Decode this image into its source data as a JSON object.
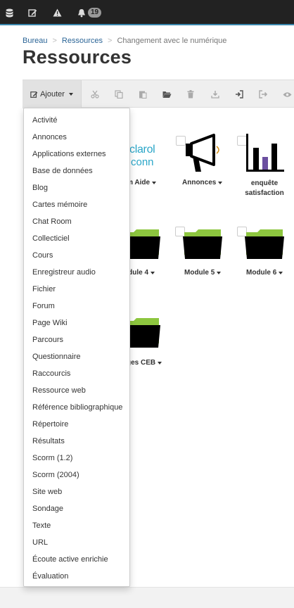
{
  "topbar": {
    "icons": [
      "database-icon",
      "edit-icon",
      "warning-icon",
      "bell-icon"
    ],
    "notifications_count": "19"
  },
  "breadcrumb": {
    "items": [
      "Bureau",
      "Ressources"
    ],
    "current": "Changement avec le numérique"
  },
  "page_title": "Ressources",
  "toolbar": {
    "add_label": "Ajouter",
    "tools": [
      "cut-icon",
      "copy-icon",
      "paste-icon",
      "open-folder-icon",
      "delete-icon",
      "download-icon",
      "import-icon",
      "export-icon",
      "view-icon"
    ]
  },
  "resources": [
    {
      "label": "um Aide",
      "icon": "claroconnect-logo"
    },
    {
      "label": "Annonces",
      "icon": "megaphone-icon"
    },
    {
      "label": "enquête satisfaction",
      "icon": "bar-chart-icon"
    },
    {
      "label": "odule 4",
      "icon": "folder-icon"
    },
    {
      "label": "Module 5",
      "icon": "folder-icon"
    },
    {
      "label": "Module 6",
      "icon": "folder-icon"
    },
    {
      "label": "ges CEB",
      "icon": "folder-icon"
    }
  ],
  "logo_text": {
    "line1": "clarol",
    "line2": "conn"
  },
  "dropdown": {
    "items": [
      "Activité",
      "Annonces",
      "Applications externes",
      "Base de données",
      "Blog",
      "Cartes mémoire",
      "Chat Room",
      "Collecticiel",
      "Cours",
      "Enregistreur audio",
      "Fichier",
      "Forum",
      "Page Wiki",
      "Parcours",
      "Questionnaire",
      "Raccourcis",
      "Ressource web",
      "Référence bibliographique",
      "Répertoire",
      "Résultats",
      "Scorm (1.2)",
      "Scorm (2004)",
      "Site web",
      "Sondage",
      "Texte",
      "URL",
      "Écoute active enrichie",
      "Évaluation"
    ]
  },
  "colors": {
    "folder_green": "#8dc63f",
    "chart_purple": "#6b4fa0",
    "link": "#2a6496"
  }
}
